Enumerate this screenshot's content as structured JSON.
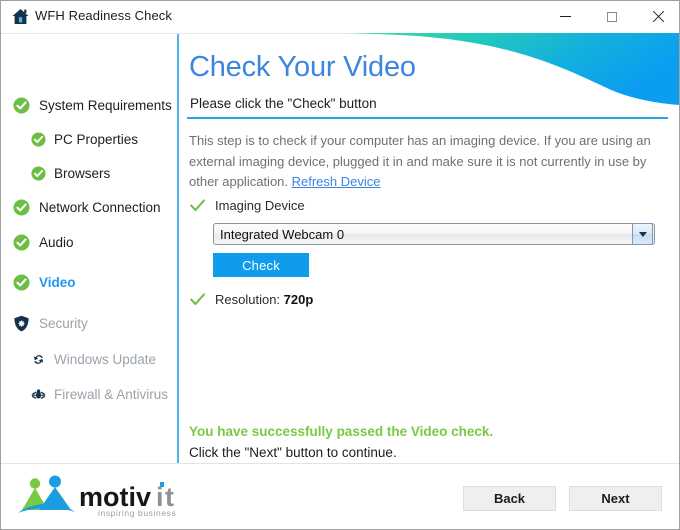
{
  "window": {
    "title": "WFH Readiness Check",
    "home_icon": "home-icon",
    "minimize_label": "Minimize",
    "maximize_label": "Maximize",
    "close_label": "Close"
  },
  "sidebar": {
    "items": [
      {
        "label": "System Requirements",
        "icon": "check-circle-icon",
        "state": "complete",
        "level": 0
      },
      {
        "label": "PC Properties",
        "icon": "check-circle-icon",
        "state": "complete",
        "level": 1
      },
      {
        "label": "Browsers",
        "icon": "check-circle-icon",
        "state": "complete",
        "level": 1
      },
      {
        "label": "Network Connection",
        "icon": "check-circle-icon",
        "state": "complete",
        "level": 0
      },
      {
        "label": "Audio",
        "icon": "check-circle-icon",
        "state": "complete",
        "level": 0
      },
      {
        "label": "Video",
        "icon": "check-circle-icon",
        "state": "active",
        "level": 0
      },
      {
        "label": "Security",
        "icon": "shield-icon",
        "state": "pending",
        "level": 0
      },
      {
        "label": "Windows Update",
        "icon": "sync-icon",
        "state": "pending",
        "level": 1
      },
      {
        "label": "Firewall & Antivirus",
        "icon": "firewall-bug-icon",
        "state": "pending",
        "level": 1
      }
    ]
  },
  "main": {
    "title": "Check Your Video",
    "subtitle": "Please click the \"Check\" button",
    "description_part1": "This step is to check if your computer has an imaging device. If you are using an external imaging device, plugged it in and make sure it is not currently in use by other application. ",
    "refresh_link": "Refresh Device",
    "imaging_device_label": "Imaging Device",
    "device_selected": "Integrated Webcam 0",
    "device_options": [
      "Integrated Webcam 0"
    ],
    "check_button": "Check",
    "resolution_label": "Resolution: ",
    "resolution_value": "720p",
    "success_message": "You have successfully passed the Video check.",
    "continue_message": "Click the \"Next\" button to continue."
  },
  "footer": {
    "logo_name": "motivit",
    "logo_tagline": "inspiring business",
    "back_button": "Back",
    "next_button": "Next"
  },
  "colors": {
    "accent_blue": "#2196f3",
    "title_blue": "#3b86e0",
    "rule_blue": "#2aa1e8",
    "button_blue": "#0f9cec",
    "success_green": "#7ac943",
    "check_green": "#6cbe45",
    "swoosh_start": "#2ad6a4",
    "swoosh_end": "#0b9ef0",
    "dim_text": "#9aa3ab",
    "body_text": "#6b7177"
  }
}
